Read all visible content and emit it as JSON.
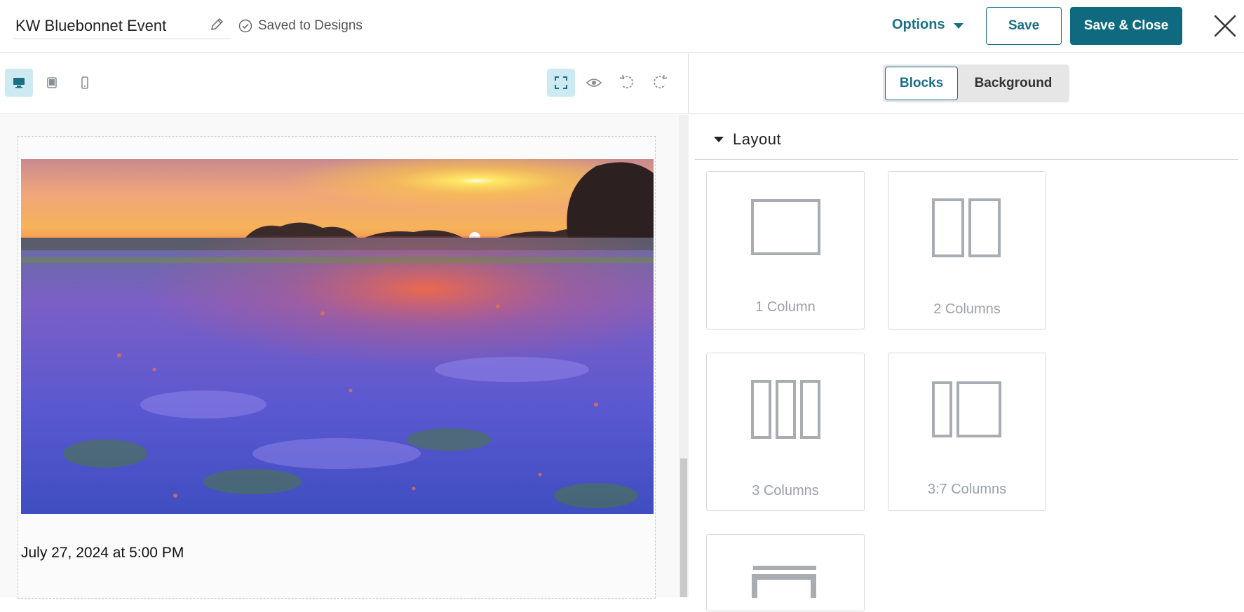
{
  "header": {
    "design_name": "KW Bluebonnet Event",
    "saved_status": "Saved to Designs",
    "options_label": "Options",
    "save_label": "Save",
    "save_close_label": "Save & Close"
  },
  "toolbar": {
    "icons": [
      "desktop-icon",
      "tablet-icon",
      "mobile-icon",
      "select-frame-icon",
      "preview-eye-icon",
      "undo-icon",
      "redo-icon"
    ],
    "active_view": "desktop"
  },
  "canvas": {
    "date_text": "July 27, 2024 at 5:00 PM"
  },
  "right_panel": {
    "tabs": [
      "Blocks",
      "Background"
    ],
    "active_tab": "Blocks",
    "section_title": "Layout",
    "layouts": [
      {
        "label": "1 Column"
      },
      {
        "label": "2 Columns"
      },
      {
        "label": "3 Columns"
      },
      {
        "label": "3:7 Columns"
      }
    ]
  },
  "colors": {
    "accent": "#0f6a80",
    "accent_text": "#1a6f86",
    "active_tool_bg": "#cdeaf2",
    "layout_icon": "#a9adb2"
  }
}
